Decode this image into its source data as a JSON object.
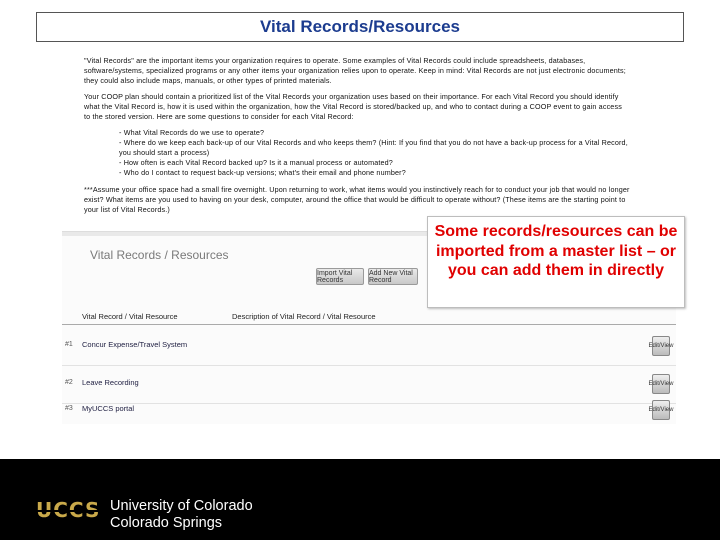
{
  "title": "Vital Records/Resources",
  "body": {
    "p1": "\"Vital Records\" are the important items your organization requires to operate. Some examples of Vital Records could include spreadsheets, databases, software/systems, specialized programs or any other items your organization relies upon to operate. Keep in mind: Vital Records are not just electronic documents; they could also include maps, manuals, or other types of printed materials.",
    "p2": "Your COOP plan should contain a prioritized list of the Vital Records your organization uses based on their importance. For each Vital Record you should identify what the Vital Record is, how it is used within the organization, how the Vital Record is stored/backed up, and who to contact during a COOP event to gain access to the stored version. Here are some questions to consider for each Vital Record:",
    "questions": [
      "- What Vital Records do we use to operate?",
      "- Where do we keep each back-up of our Vital Records and who keeps them? (Hint: If you find that you do not have a back-up process for a Vital Record, you should start a process)",
      "- How often is each Vital Record backed up? Is it a manual process or automated?",
      "- Who do I contact to request back-up versions; what's their email and phone number?"
    ],
    "p3": "***Assume your office space had a small fire overnight. Upon returning to work, what items would you instinctively reach for to conduct your job that would no longer exist? What items are you used to having on your desk, computer, around the office that would be difficult to operate without? (These items are the starting point to your list of Vital Records.)"
  },
  "screen": {
    "heading": "Vital Records / Resources",
    "buttons": {
      "import": "Import Vital Records",
      "add": "Add New Vital Record"
    },
    "columns": [
      "Vital Record / Vital Resource",
      "Description of Vital Record / Vital Resource"
    ],
    "rows": [
      {
        "num": "#1",
        "name": "Concur Expense/Travel System",
        "edit": "Edit/View"
      },
      {
        "num": "#2",
        "name": "Leave Recording",
        "edit": "Edit/View"
      },
      {
        "num": "#3",
        "name": "MyUCCS portal",
        "edit": "Edit/View"
      }
    ]
  },
  "callout": "Some records/resources can be imported from a master list – or you can add them in directly",
  "footer": {
    "logo": "UCCS",
    "line1": "University of Colorado",
    "line2": "Colorado Springs"
  },
  "colors": {
    "title": "#1c3c8f",
    "callout_text": "#e00000",
    "footer_bg": "#000000",
    "logo_gold": "#c9a94a"
  }
}
